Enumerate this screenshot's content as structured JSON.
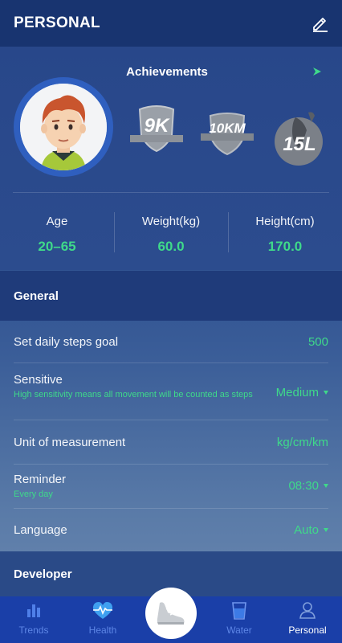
{
  "header": {
    "title": "PERSONAL",
    "edit_icon": "pencil-icon"
  },
  "achievements": {
    "title": "Achievements",
    "badges": [
      {
        "label": "9K",
        "icon": "shield-badge-icon"
      },
      {
        "label": "10KM",
        "icon": "shield-badge-icon"
      },
      {
        "label": "15L",
        "icon": "water-drop-badge-icon"
      }
    ]
  },
  "stats": [
    {
      "label": "Age",
      "value": "20–65"
    },
    {
      "label": "Weight(kg)",
      "value": "60.0"
    },
    {
      "label": "Height(cm)",
      "value": "170.0"
    }
  ],
  "general": {
    "title": "General",
    "rows": [
      {
        "label": "Set daily steps goal",
        "value": "500"
      },
      {
        "label": "Sensitive",
        "sub": "High sensitivity means all movement will be counted as steps",
        "value": "Medium"
      },
      {
        "label": "Unit of measurement",
        "value": "kg/cm/km"
      },
      {
        "label": "Reminder",
        "sub": "Every day",
        "value": "08:30"
      },
      {
        "label": "Language",
        "value": "Auto"
      }
    ]
  },
  "developer": {
    "title": "Developer"
  },
  "nav": {
    "items": [
      {
        "label": "Trends",
        "icon": "bar-chart-icon"
      },
      {
        "label": "Health",
        "icon": "heart-pulse-icon"
      },
      {
        "label": "Water",
        "icon": "water-cup-icon"
      },
      {
        "label": "Personal",
        "icon": "person-icon"
      }
    ],
    "center_icon": "shoe-icon",
    "active": "Personal"
  },
  "colors": {
    "accent_green": "#3fd98a",
    "header_blue": "#183470",
    "nav_blue": "#1a3fa8"
  }
}
